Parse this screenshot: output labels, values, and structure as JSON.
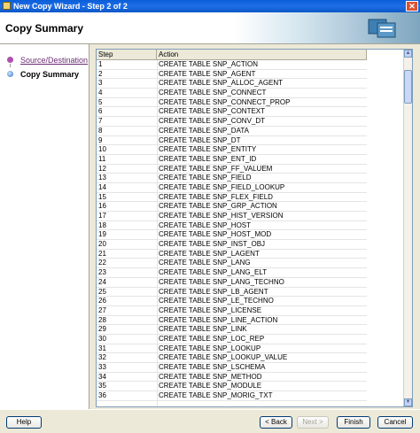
{
  "window": {
    "title": "New Copy Wizard - Step 2 of 2",
    "close_label": "✕"
  },
  "header": {
    "title": "Copy Summary"
  },
  "nav": {
    "items": [
      {
        "label": "Source/Destination"
      },
      {
        "label": "Copy Summary"
      }
    ]
  },
  "table": {
    "columns": [
      "Step",
      "Action"
    ],
    "rows": [
      [
        "1",
        "CREATE TABLE SNP_ACTION"
      ],
      [
        "2",
        "CREATE TABLE SNP_AGENT"
      ],
      [
        "3",
        "CREATE TABLE SNP_ALLOC_AGENT"
      ],
      [
        "4",
        "CREATE TABLE SNP_CONNECT"
      ],
      [
        "5",
        "CREATE TABLE SNP_CONNECT_PROP"
      ],
      [
        "6",
        "CREATE TABLE SNP_CONTEXT"
      ],
      [
        "7",
        "CREATE TABLE SNP_CONV_DT"
      ],
      [
        "8",
        "CREATE TABLE SNP_DATA"
      ],
      [
        "9",
        "CREATE TABLE SNP_DT"
      ],
      [
        "10",
        "CREATE TABLE SNP_ENTITY"
      ],
      [
        "11",
        "CREATE TABLE SNP_ENT_ID"
      ],
      [
        "12",
        "CREATE TABLE SNP_FF_VALUEM"
      ],
      [
        "13",
        "CREATE TABLE SNP_FIELD"
      ],
      [
        "14",
        "CREATE TABLE SNP_FIELD_LOOKUP"
      ],
      [
        "15",
        "CREATE TABLE SNP_FLEX_FIELD"
      ],
      [
        "16",
        "CREATE TABLE SNP_GRP_ACTION"
      ],
      [
        "17",
        "CREATE TABLE SNP_HIST_VERSION"
      ],
      [
        "18",
        "CREATE TABLE SNP_HOST"
      ],
      [
        "19",
        "CREATE TABLE SNP_HOST_MOD"
      ],
      [
        "20",
        "CREATE TABLE SNP_INST_OBJ"
      ],
      [
        "21",
        "CREATE TABLE SNP_LAGENT"
      ],
      [
        "22",
        "CREATE TABLE SNP_LANG"
      ],
      [
        "23",
        "CREATE TABLE SNP_LANG_ELT"
      ],
      [
        "24",
        "CREATE TABLE SNP_LANG_TECHNO"
      ],
      [
        "25",
        "CREATE TABLE SNP_LB_AGENT"
      ],
      [
        "26",
        "CREATE TABLE SNP_LE_TECHNO"
      ],
      [
        "27",
        "CREATE TABLE SNP_LICENSE"
      ],
      [
        "28",
        "CREATE TABLE SNP_LINE_ACTION"
      ],
      [
        "29",
        "CREATE TABLE SNP_LINK"
      ],
      [
        "30",
        "CREATE TABLE SNP_LOC_REP"
      ],
      [
        "31",
        "CREATE TABLE SNP_LOOKUP"
      ],
      [
        "32",
        "CREATE TABLE SNP_LOOKUP_VALUE"
      ],
      [
        "33",
        "CREATE TABLE SNP_LSCHEMA"
      ],
      [
        "34",
        "CREATE TABLE SNP_METHOD"
      ],
      [
        "35",
        "CREATE TABLE SNP_MODULE"
      ],
      [
        "36",
        "CREATE TABLE SNP_MORIG_TXT"
      ]
    ]
  },
  "buttons": {
    "help": "Help",
    "back": "< Back",
    "next": "Next >",
    "finish": "Finish",
    "cancel": "Cancel"
  }
}
